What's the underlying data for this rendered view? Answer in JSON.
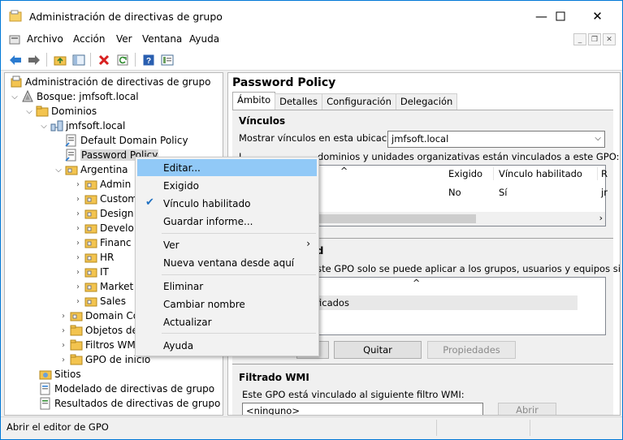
{
  "window": {
    "title": "Administración de directivas de grupo"
  },
  "menubar": {
    "items": [
      "Archivo",
      "Acción",
      "Ver",
      "Ventana",
      "Ayuda"
    ]
  },
  "toolbar": {
    "buttons": [
      "back-arrow-icon",
      "forward-arrow-icon",
      "up-folder-icon",
      "show-hide-tree-icon",
      "delete-icon",
      "refresh-icon",
      "help-icon",
      "properties-icon"
    ]
  },
  "tree": {
    "root": "Administración de directivas de grupo",
    "forest": "Bosque: jmfsoft.local",
    "domains": "Dominios",
    "domain": "jmfsoft.local",
    "default_policy": "Default Domain Policy",
    "password_policy": "Password Policy",
    "argentina": "Argentina",
    "children": [
      "Admin",
      "Custom",
      "Design",
      "Develo",
      "Financ",
      "HR",
      "IT",
      "Market",
      "Sales"
    ],
    "domain_controllers": "Domain Co",
    "objects": "Objetos de",
    "wmi_filters": "Filtros WM",
    "starter_gpo": "GPO de inicio",
    "sites": "Sitios",
    "modeling": "Modelado de directivas de grupo",
    "results": "Resultados de directivas de grupo"
  },
  "details": {
    "title": "Password Policy",
    "tabs": [
      "Ámbito",
      "Detalles",
      "Configuración",
      "Delegación"
    ],
    "links_heading": "Vínculos",
    "show_links_label": "Mostrar vínculos en esta ubicación:",
    "location_value": "jmfsoft.local",
    "links_desc_visible": "dominios y unidades organizativas están vinculados a este GPO:",
    "links_desc_left": "L",
    "columns": [
      "Exigido",
      "Vínculo habilitado",
      "R"
    ],
    "row": {
      "exigido": "No",
      "vinculo": "Sí",
      "ruta": "jr"
    },
    "security_heading_fragment": "dad",
    "security_desc_fragment": "este GPO solo se puede aplicar a los grupos, usuarios y equipos siguientes:",
    "security_row_fragment": "ficados",
    "buttons": {
      "quitar": "Quitar",
      "propiedades": "Propiedades"
    },
    "wmi_heading": "Filtrado WMI",
    "wmi_desc": "Este GPO está vinculado al siguiente filtro WMI:",
    "wmi_value": "<ninguno>",
    "wmi_open": "Abrir"
  },
  "context_menu": {
    "editar": "Editar...",
    "exigido": "Exigido",
    "vinculo_habilitado": "Vínculo habilitado",
    "vinculo_checked": true,
    "guardar_informe": "Guardar informe...",
    "ver": "Ver",
    "nueva_ventana": "Nueva ventana desde aquí",
    "eliminar": "Eliminar",
    "cambiar_nombre": "Cambiar nombre",
    "actualizar": "Actualizar",
    "ayuda": "Ayuda"
  },
  "status": {
    "text": "Abrir el editor de GPO"
  },
  "colors": {
    "accent": "#0078d7",
    "menu_highlight": "#91c9f7",
    "selection": "#d9d9d9"
  }
}
